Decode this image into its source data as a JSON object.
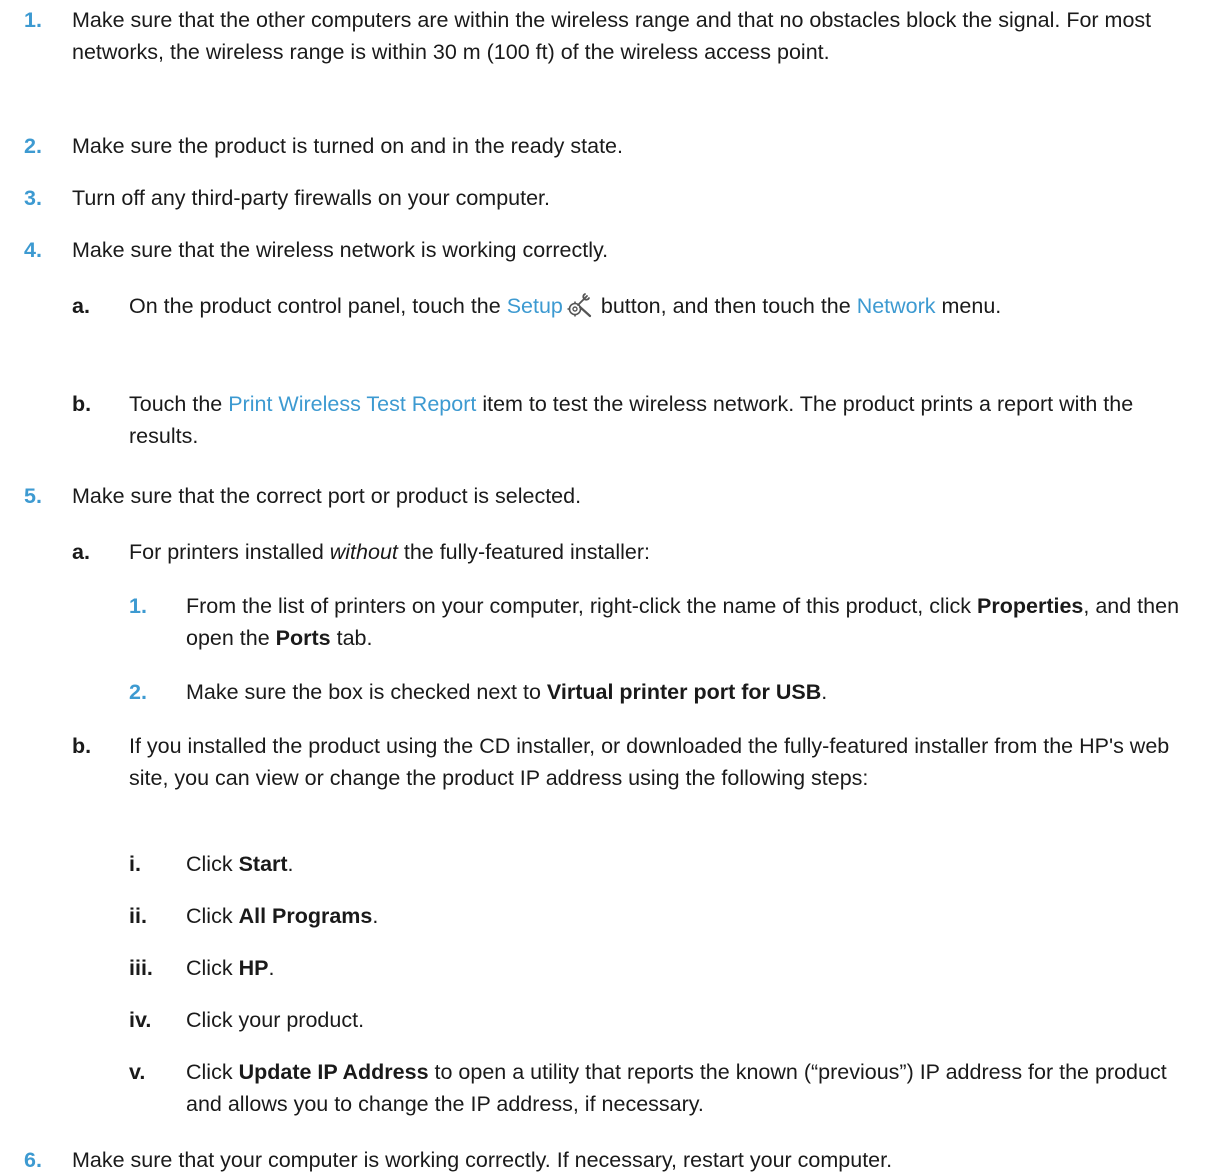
{
  "steps": [
    {
      "num": "1.",
      "text": "Make sure that the other computers are within the wireless range and that no obstacles block the signal. For most networks, the wireless range is within 30 m (100 ft) of the wireless access point."
    },
    {
      "num": "2.",
      "text": "Make sure the product is turned on and in the ready state."
    },
    {
      "num": "3.",
      "text": "Turn off any third-party firewalls on your computer."
    },
    {
      "num": "4.",
      "text": "Make sure that the wireless network is working correctly.",
      "sub": [
        {
          "num": "a.",
          "t1": "On the product control panel, touch the ",
          "link1": "Setup",
          "t2": " button, and then touch the ",
          "link2": "Network",
          "t3": " menu."
        },
        {
          "num": "b.",
          "t1": "Touch the ",
          "link1": "Print Wireless Test Report",
          "t2": " item to test the wireless network. The product prints a report with the results."
        }
      ]
    },
    {
      "num": "5.",
      "text": "Make sure that the correct port or product is selected.",
      "sub_a": {
        "num": "a.",
        "t1": "For printers installed ",
        "em": "without",
        "t2": " the fully-featured installer:",
        "items": [
          {
            "num": "1.",
            "t1": "From the list of printers on your computer, right-click the name of this product, click ",
            "b1": "Properties",
            "t2": ", and then open the ",
            "b2": "Ports",
            "t3": " tab."
          },
          {
            "num": "2.",
            "t1": "Make sure the box is checked next to ",
            "b1": "Virtual printer port for USB",
            "t2": "."
          }
        ]
      },
      "sub_b": {
        "num": "b.",
        "text": "If you installed the product using the CD installer, or downloaded the fully-featured installer from the HP's web site, you can view or change the product IP address using the following steps:",
        "items": [
          {
            "num": "i.",
            "t1": "Click ",
            "b1": "Start",
            "t2": "."
          },
          {
            "num": "ii.",
            "t1": "Click ",
            "b1": "All Programs",
            "t2": "."
          },
          {
            "num": "iii.",
            "t1": "Click ",
            "b1": "HP",
            "t2": "."
          },
          {
            "num": "iv.",
            "t1": "Click your product.",
            "b1": "",
            "t2": ""
          },
          {
            "num": "v.",
            "t1": "Click ",
            "b1": "Update IP Address",
            "t2": " to open a utility that reports the known (“previous”) IP address for the product and allows you to change the IP address, if necessary."
          }
        ]
      }
    },
    {
      "num": "6.",
      "text": "Make sure that your computer is working correctly. If necessary, restart your computer."
    }
  ],
  "icons": {
    "setup": "setup-wrench-gear-icon"
  },
  "colors": {
    "accent": "#3d9ad1"
  }
}
